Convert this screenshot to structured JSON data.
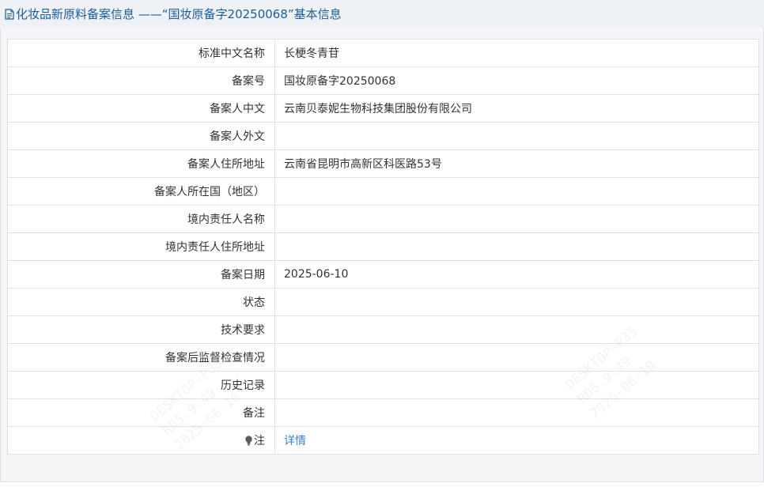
{
  "header": {
    "title": "化妆品新原料备案信息 ——“国妆原备字20250068”基本信息"
  },
  "rows": [
    {
      "label": "标准中文名称",
      "value": "长梗冬青苷"
    },
    {
      "label": "备案号",
      "value": "国妆原备字20250068"
    },
    {
      "label": "备案人中文",
      "value": "云南贝泰妮生物科技集团股份有限公司"
    },
    {
      "label": "备案人外文",
      "value": ""
    },
    {
      "label": "备案人住所地址",
      "value": "云南省昆明市高新区科医路53号"
    },
    {
      "label": "备案人所在国（地区）",
      "value": ""
    },
    {
      "label": "境内责任人名称",
      "value": ""
    },
    {
      "label": "境内责任人住所地址",
      "value": ""
    },
    {
      "label": "备案日期",
      "value": "2025-06-10"
    },
    {
      "label": "状态",
      "value": ""
    },
    {
      "label": "技术要求",
      "value": ""
    },
    {
      "label": "备案后监督检查情况",
      "value": ""
    },
    {
      "label": "历史记录",
      "value": ""
    },
    {
      "label": "备注",
      "value": ""
    }
  ],
  "note_row": {
    "icon": "lightbulb-icon",
    "label": "注",
    "link_text": "详情"
  },
  "colors": {
    "title": "#1d5d95",
    "link": "#3a84c9",
    "border": "#dde1e6",
    "panel_bg": "#f4f5f7"
  }
}
